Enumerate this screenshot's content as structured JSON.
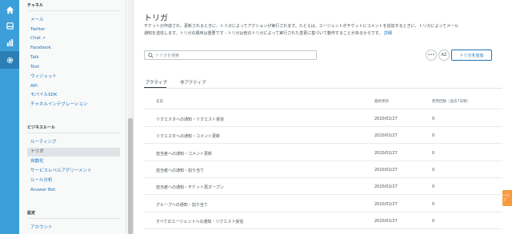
{
  "nav": {
    "channels_heading": "チャネル",
    "channels": [
      "メール",
      "Twitter",
      "Chat",
      "Facebook",
      "Talk",
      "Text",
      "ウィジェット",
      "API",
      "モバイルSDK",
      "チャネルインテグレーション"
    ],
    "business_heading": "ビジネスルール",
    "business": [
      "ルーティング",
      "トリガ",
      "自動化",
      "サービスレベルアグリーメント",
      "ルール分析",
      "Answer Bot"
    ],
    "selected": "トリガ",
    "settings_heading": "設定",
    "settings": [
      "アカウント"
    ]
  },
  "page": {
    "title": "トリガ",
    "description_line1": "チケットが作成され、更新されるときに、トリガによってアクションが実行されます。たとえば、エージェントがチケットにコメントを追加するときに、トリガによってメール",
    "description_line2": "通知を送信します。トリガの順序は重要です - トリガは他のトリガによって実行された変更に基づいて動作することがあるからです。",
    "description_link": "詳細"
  },
  "search": {
    "placeholder": "トリガを検索"
  },
  "toolbar": {
    "more_label": "•••",
    "sort_label": "AZ",
    "add_label": "トリガを追加"
  },
  "tabs": [
    {
      "label": "アクティブ"
    },
    {
      "label": "非アクティブ"
    }
  ],
  "table": {
    "columns": [
      "名前",
      "最終更新",
      "使用回数（過去7日間）"
    ],
    "rows": [
      {
        "name": "リクエスタへの通知・リクエスト受信",
        "updated": "2020/02/27",
        "usage": "0"
      },
      {
        "name": "リクエスタへの通知・コメント更新",
        "updated": "2020/02/27",
        "usage": "0"
      },
      {
        "name": "担当者への通知・コメント更新",
        "updated": "2020/02/27",
        "usage": "0"
      },
      {
        "name": "担当者への通知・割り当て",
        "updated": "2020/02/27",
        "usage": "0"
      },
      {
        "name": "担当者への通知・チケット再オープン",
        "updated": "2020/02/27",
        "usage": "0"
      },
      {
        "name": "グループへの通知・割り当て",
        "updated": "2020/02/27",
        "usage": "0"
      },
      {
        "name": "すべてのエージェントへの通知・リクエスト受信",
        "updated": "2020/02/27",
        "usage": "0"
      }
    ]
  },
  "side_tab": {
    "label": "ヘルプ"
  },
  "colors": {
    "rail": "#3c9fd9",
    "link": "#1f73b7",
    "side_tab": "#f79a3e"
  }
}
